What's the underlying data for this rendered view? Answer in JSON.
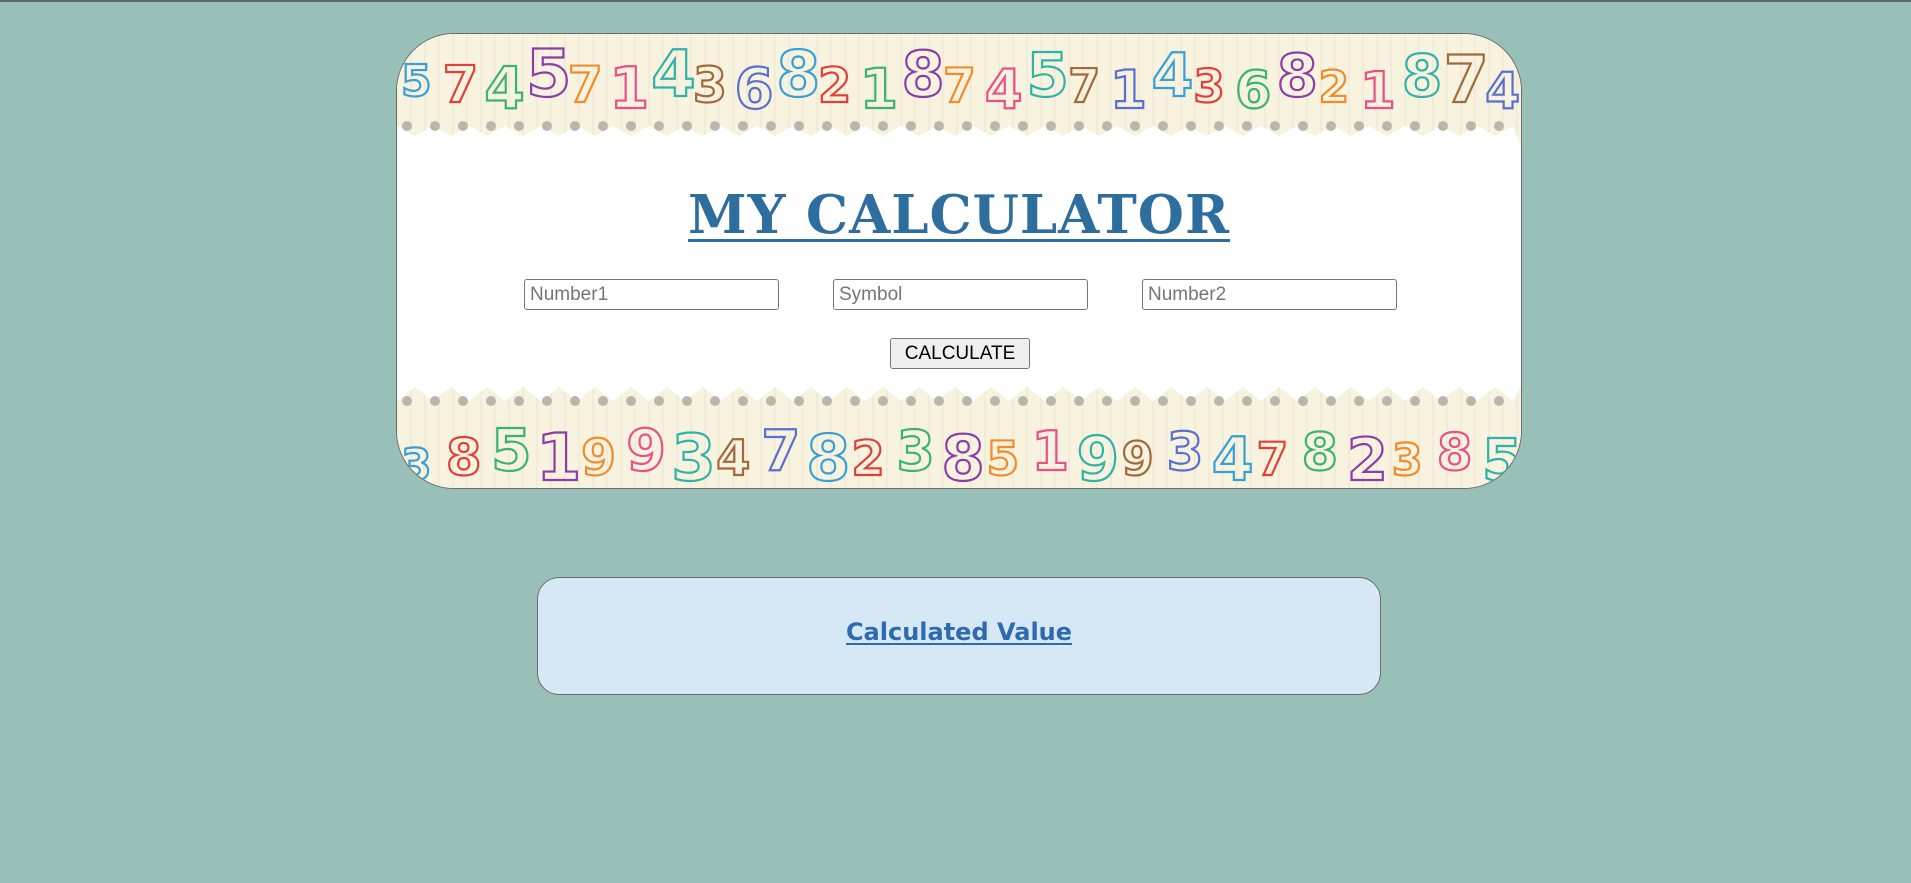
{
  "header": {
    "title": "MY CALCULATOR"
  },
  "form": {
    "number1_placeholder": "Number1",
    "symbol_placeholder": "Symbol",
    "number2_placeholder": "Number2",
    "calculate_label": "CALCULATE"
  },
  "result": {
    "title": "Calculated Value"
  },
  "colors": {
    "page_background": "#98c0b8",
    "title": "#2e6e9e",
    "result_background": "#d6e7f5",
    "result_title": "#2f6aae"
  },
  "decor": {
    "border_top_glyphs": [
      "5",
      "7",
      "4",
      "5",
      "7",
      "1",
      "4",
      "3",
      "6",
      "8",
      "2",
      "1",
      "8",
      "7",
      "4",
      "5",
      "7",
      "1",
      "4",
      "3",
      "6",
      "8",
      "2",
      "1",
      "8",
      "7",
      "4"
    ],
    "border_bottom_glyphs": [
      "3",
      "8",
      "5",
      "1",
      "9",
      "9",
      "3",
      "4",
      "7",
      "8",
      "2",
      "3",
      "8",
      "5",
      "1",
      "9",
      "9",
      "3",
      "4",
      "7",
      "8",
      "2",
      "3",
      "8",
      "5"
    ]
  }
}
